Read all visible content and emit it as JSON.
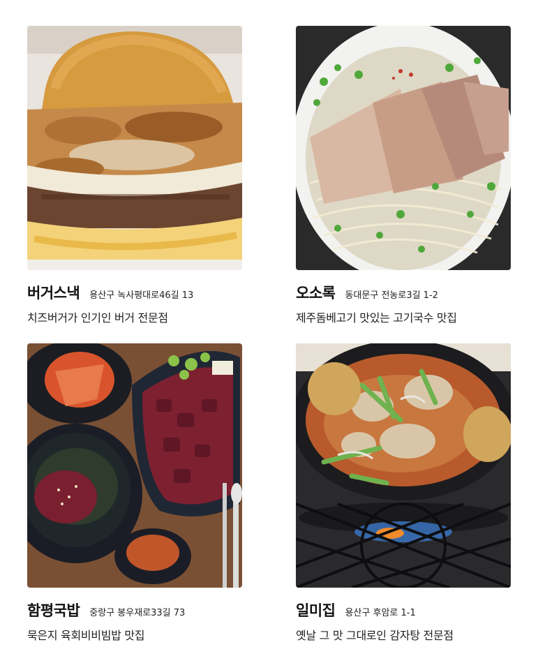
{
  "restaurants": [
    {
      "name": "버거스낵",
      "address": "용산구 녹사평대로46길 13",
      "description": "치즈버거가 인기인 버거 전문점",
      "photo_icon": "burger-photo"
    },
    {
      "name": "오소록",
      "address": "동대문구 전농로3길 1-2",
      "description": "제주돔베고기 맛있는 고기국수 맛집",
      "photo_icon": "noodle-soup-photo"
    },
    {
      "name": "함평국밥",
      "address": "중랑구 봉우재로33길 73",
      "description": "묵은지 육회비비빔밥 맛집",
      "photo_icon": "yukhoe-bibimbap-photo"
    },
    {
      "name": "일미집",
      "address": "용산구 후암로 1-1",
      "description": "옛날 그 맛 그대로인 감자탕 전문점",
      "photo_icon": "gamjatang-photo"
    }
  ]
}
